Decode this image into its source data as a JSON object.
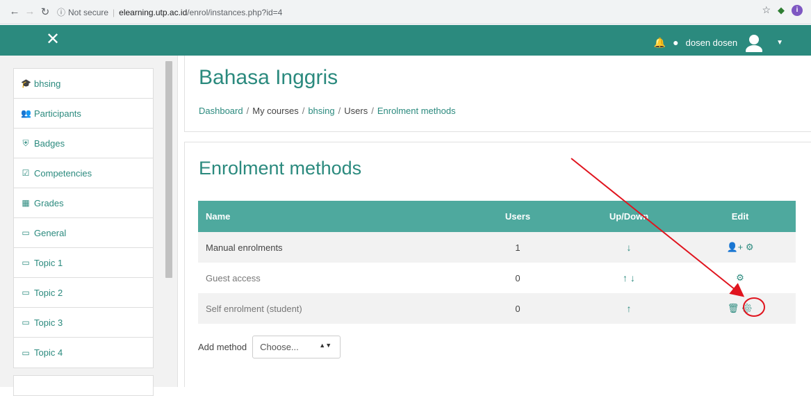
{
  "browser": {
    "security": "Not secure",
    "host": "elearning.utp.ac.id",
    "path": "/enrol/instances.php?id=4",
    "extension_letter": "i"
  },
  "topbar": {
    "user_name": "dosen dosen"
  },
  "sidebar": {
    "items": [
      {
        "icon": "graduation-cap-icon",
        "glyph": "🎓",
        "label": "bhsing"
      },
      {
        "icon": "users-icon",
        "glyph": "👥",
        "label": "Participants"
      },
      {
        "icon": "shield-icon",
        "glyph": "⛨",
        "label": "Badges"
      },
      {
        "icon": "check-square-icon",
        "glyph": "☑",
        "label": "Competencies"
      },
      {
        "icon": "table-icon",
        "glyph": "▦",
        "label": "Grades"
      },
      {
        "icon": "folder-icon",
        "glyph": "▭",
        "label": "General"
      },
      {
        "icon": "folder-icon",
        "glyph": "▭",
        "label": "Topic 1"
      },
      {
        "icon": "folder-icon",
        "glyph": "▭",
        "label": "Topic 2"
      },
      {
        "icon": "folder-icon",
        "glyph": "▭",
        "label": "Topic 3"
      },
      {
        "icon": "folder-icon",
        "glyph": "▭",
        "label": "Topic 4"
      }
    ]
  },
  "header": {
    "title": "Bahasa Inggris",
    "breadcrumb": [
      "Dashboard",
      "My courses",
      "bhsing",
      "Users",
      "Enrolment methods"
    ]
  },
  "main": {
    "heading": "Enrolment methods",
    "columns": [
      "Name",
      "Users",
      "Up/Down",
      "Edit"
    ],
    "rows": [
      {
        "name": "Manual enrolments",
        "users": "1",
        "updown": "↓",
        "edit": "👤+ ⚙"
      },
      {
        "name": "Guest access",
        "users": "0",
        "updown": "↑ ↓",
        "edit": "⚙"
      },
      {
        "name": "Self enrolment (student)",
        "users": "0",
        "updown": "↑",
        "edit": "🗑 ⚙"
      }
    ],
    "add_method_label": "Add method",
    "select_value": "Choose...",
    "select_arrows": "▲▼"
  },
  "colors": {
    "brand": "#2b8a7e",
    "table_header": "#4ea99e",
    "annotation": "#e0141e"
  }
}
